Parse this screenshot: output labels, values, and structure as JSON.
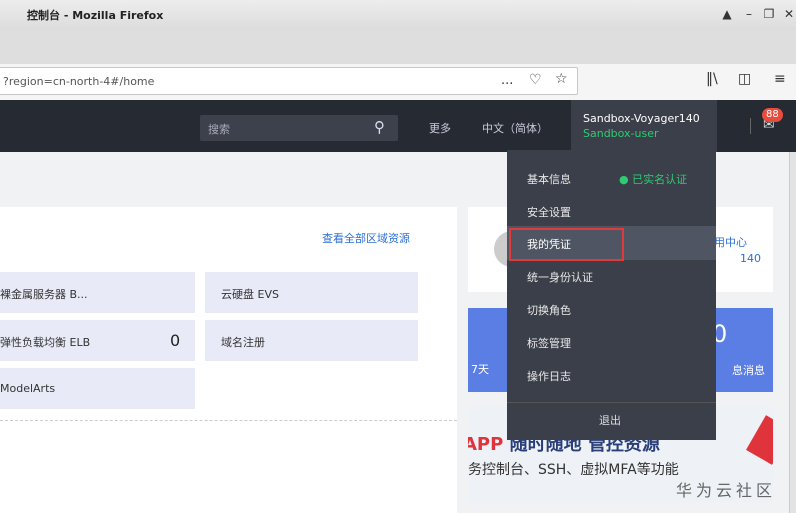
{
  "window": {
    "title": "控制台 - Mozilla Firefox"
  },
  "browser": {
    "url": "?region=cn-north-4#/home",
    "more_icon": "...",
    "pocket_icon": "pocket-icon",
    "bookmark_icon": "star-icon"
  },
  "header": {
    "search_placeholder": "搜索",
    "more": "更多",
    "language": "中文（简体）",
    "username": "Sandbox-Voyager140",
    "role": "Sandbox-user",
    "badge": "88"
  },
  "main": {
    "view_all": "查看全部区域资源",
    "services": [
      {
        "label": "裸金属服务器 B..."
      },
      {
        "label": "云硬盘 EVS"
      },
      {
        "label": "弹性负载均衡 ELB",
        "count": "0"
      },
      {
        "label": "域名注册"
      },
      {
        "label": "ModelArts"
      }
    ]
  },
  "right": {
    "link": "用中心",
    "num": "140",
    "blue_left": "7天",
    "blue_num": "0",
    "blue_msg": "息消息",
    "promo_line1_a": "APP",
    "promo_line1_b": " 随时随地 管控资源",
    "promo_line2": "务控制台、SSH、虚拟MFA等功能",
    "watermark": "华为云社区"
  },
  "dropdown": {
    "items": [
      {
        "label": "基本信息"
      },
      {
        "label": "安全设置"
      },
      {
        "label": "我的凭证"
      },
      {
        "label": "统一身份认证"
      },
      {
        "label": "切换角色"
      },
      {
        "label": "标签管理"
      },
      {
        "label": "操作日志"
      }
    ],
    "verified": "已实名认证",
    "logout": "退出"
  },
  "colors": {
    "header_bg": "#262a33",
    "accent_green": "#2ecc71",
    "link_blue": "#2b6fd6",
    "highlight_red": "#e03b3b"
  }
}
